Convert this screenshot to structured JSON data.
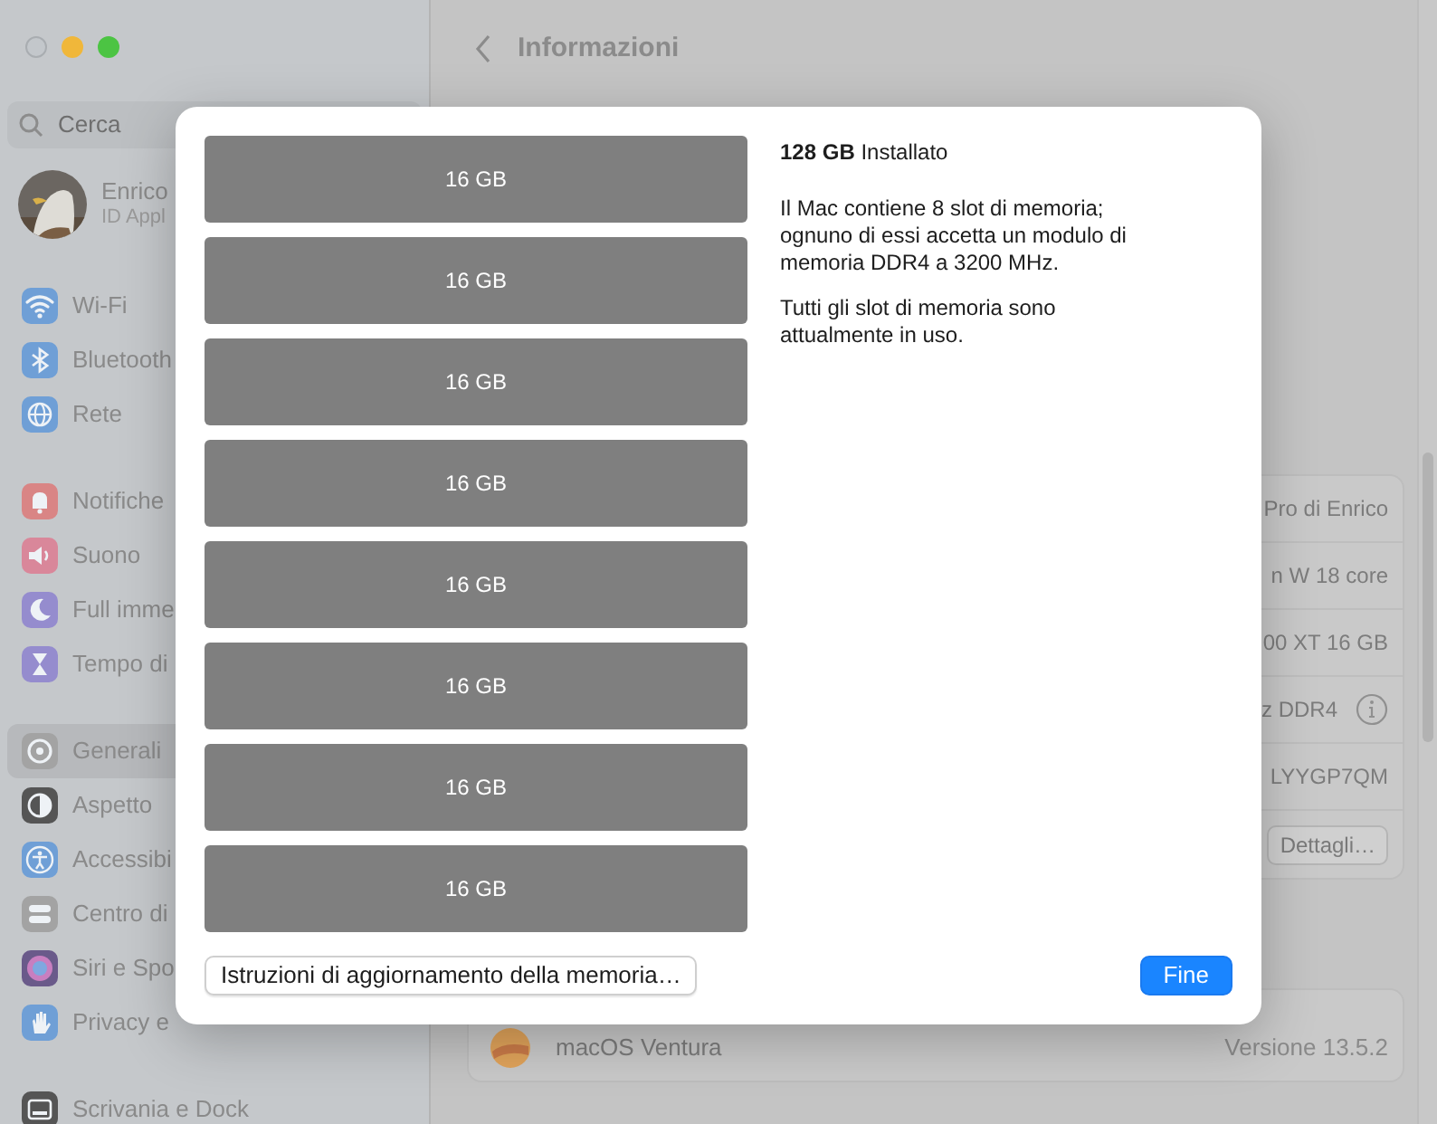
{
  "window": {
    "title": "Informazioni"
  },
  "sidebar": {
    "search": {
      "placeholder": "Cerca"
    },
    "account": {
      "name": "Enrico",
      "subtitle": "ID Appl"
    },
    "groups": [
      [
        {
          "label": "Wi-Fi",
          "color": "#6f9fd6",
          "selected": false
        },
        {
          "label": "Bluetooth",
          "color": "#6f9fd6",
          "selected": false
        },
        {
          "label": "Rete",
          "color": "#6f9fd6",
          "selected": false
        }
      ],
      [
        {
          "label": "Notifiche",
          "color": "#d98585",
          "selected": false
        },
        {
          "label": "Suono",
          "color": "#d9879a",
          "selected": false
        },
        {
          "label": "Full imme",
          "color": "#958cce",
          "selected": false
        },
        {
          "label": "Tempo di",
          "color": "#958cce",
          "selected": false
        }
      ],
      [
        {
          "label": "Generali",
          "color": "#a3a3a3",
          "selected": true
        },
        {
          "label": "Aspetto",
          "color": "#555555",
          "selected": false
        },
        {
          "label": "Accessibi",
          "color": "#6f9fd6",
          "selected": false
        },
        {
          "label": "Centro di",
          "color": "#a3a3a3",
          "selected": false
        },
        {
          "label": "Siri e Spo",
          "color": "#6a5a8a",
          "selected": false
        },
        {
          "label": "Privacy e",
          "color": "#6f9fd6",
          "selected": false
        }
      ],
      [
        {
          "label": "Scrivania e Dock",
          "color": "#555555",
          "selected": false
        }
      ]
    ]
  },
  "details": {
    "rows": [
      {
        "kind": "text",
        "value": "Pro di Enrico"
      },
      {
        "kind": "text",
        "value": "n W 18 core"
      },
      {
        "kind": "text",
        "value": "00 XT 16 GB"
      },
      {
        "kind": "info",
        "value": "z DDR4"
      },
      {
        "kind": "text",
        "value": "LYYGP7QM"
      },
      {
        "kind": "button",
        "value": "Dettagli…"
      }
    ]
  },
  "software": {
    "name": "macOS Ventura",
    "version": "Versione 13.5.2"
  },
  "memory_sheet": {
    "slots": [
      {
        "label": "16 GB"
      },
      {
        "label": "16 GB"
      },
      {
        "label": "16 GB"
      },
      {
        "label": "16 GB"
      },
      {
        "label": "16 GB"
      },
      {
        "label": "16 GB"
      },
      {
        "label": "16 GB"
      },
      {
        "label": "16 GB"
      }
    ],
    "installed": "**128 GB** Installato",
    "paragraphs": [
      "Il Mac contiene 8 slot di memoria; ognuno di essi accetta un modulo di memoria DDR4 a 3200 MHz.",
      "Tutti gli slot di memoria sono attualmente in uso."
    ],
    "buttons": [
      {
        "kind": "default",
        "label": "Istruzioni di aggiornamento della memoria…"
      },
      {
        "kind": "primary",
        "label": "Fine"
      }
    ]
  }
}
